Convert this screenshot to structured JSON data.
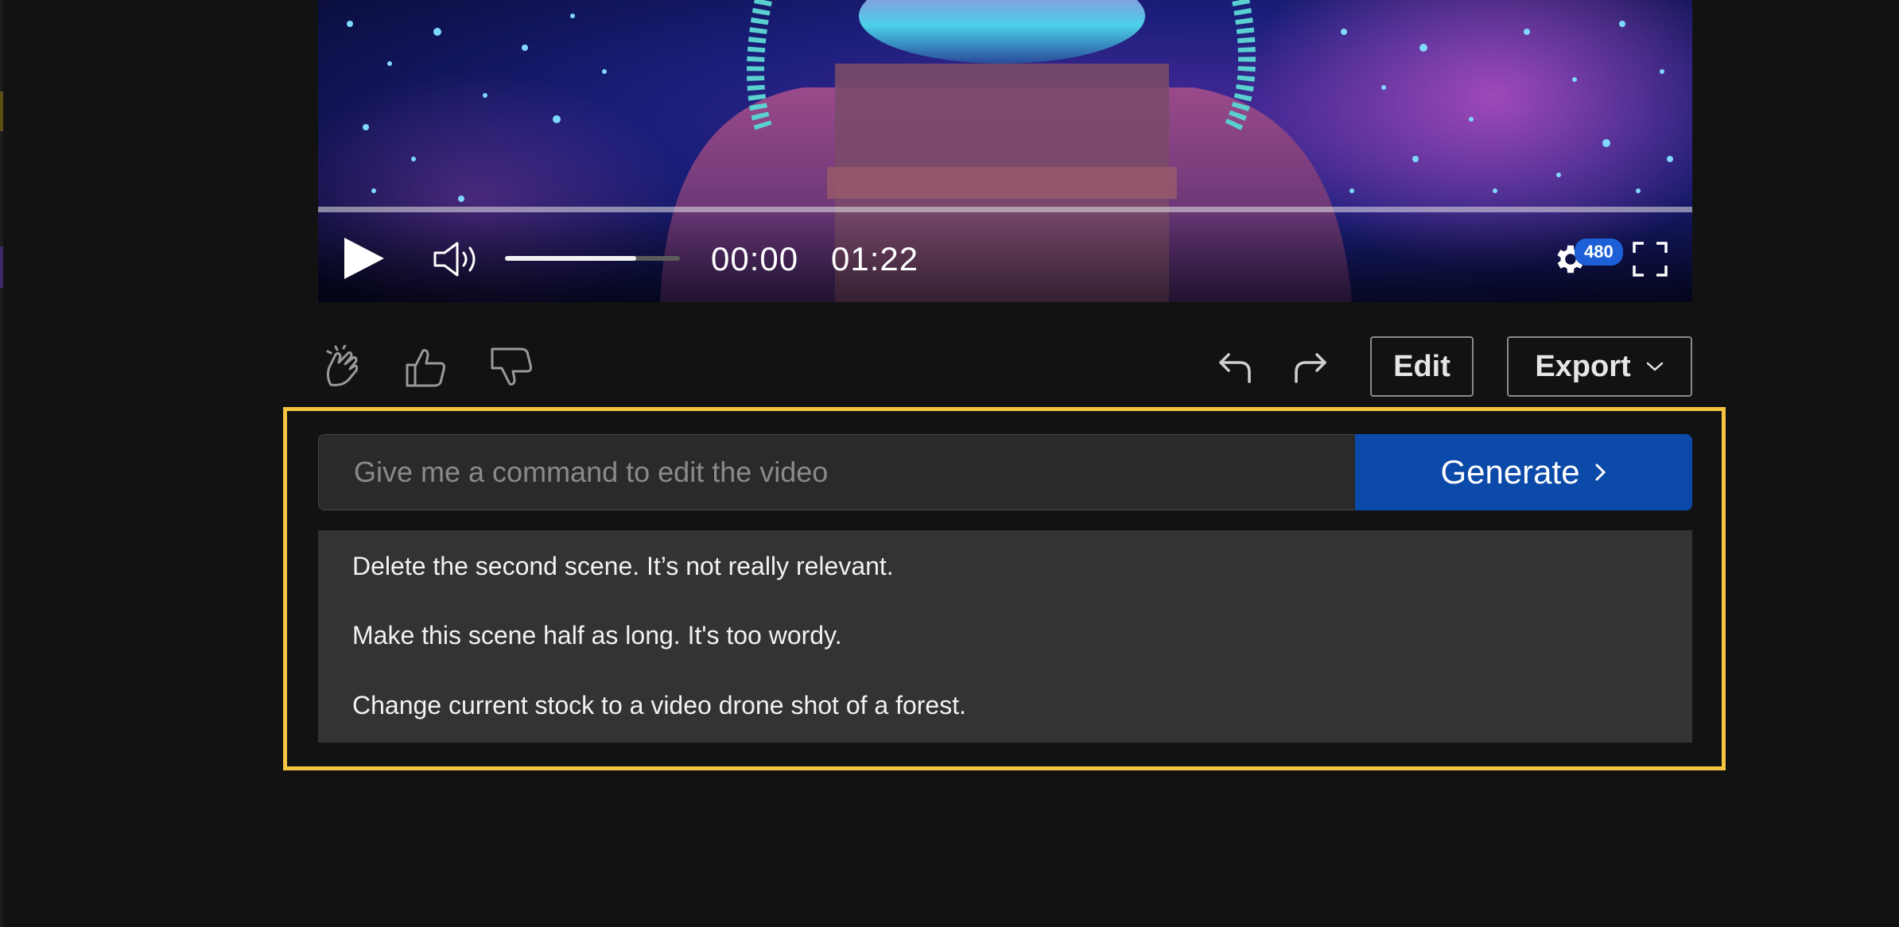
{
  "player": {
    "current_time": "00:00",
    "total_time": "01:22",
    "quality": "480",
    "progress": 0.0,
    "volume": 0.75,
    "icons": [
      "play-icon",
      "volume-icon",
      "settings-icon",
      "fullscreen-icon"
    ]
  },
  "feedback": {
    "icons": [
      "clapping-hands-icon",
      "thumbs-up-icon",
      "thumbs-down-icon"
    ]
  },
  "history": {
    "icons": [
      "undo-icon",
      "redo-icon"
    ]
  },
  "actions": {
    "edit_label": "Edit",
    "export_label": "Export"
  },
  "command": {
    "placeholder": "Give me a command to edit the video",
    "value": "",
    "generate_label": "Generate"
  },
  "suggestions": [
    "Delete the second scene. It’s not really relevant.",
    "Make this scene half as long. It's too wordy.",
    "Change current stock to a video drone shot of a forest."
  ],
  "colors": {
    "background": "#121212",
    "highlight": "#f5c542",
    "generate_button": "#0b4aa8",
    "quality_badge": "#1c5fd6"
  }
}
